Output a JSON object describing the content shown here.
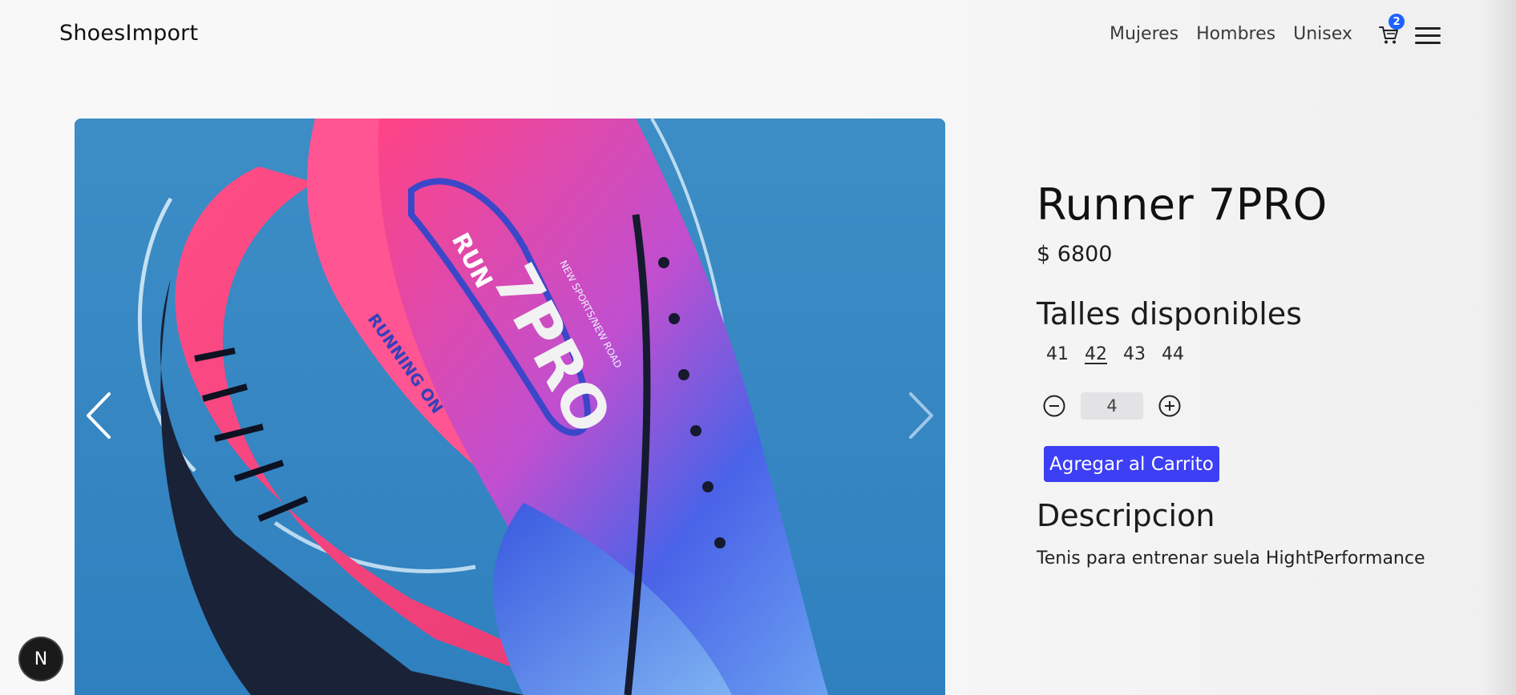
{
  "header": {
    "brand": "ShoesImport",
    "nav": [
      "Mujeres",
      "Hombres",
      "Unisex"
    ],
    "cart_count": "2"
  },
  "product": {
    "name": "Runner 7PRO",
    "price": "$ 6800",
    "sizes_title": "Talles disponibles",
    "sizes": [
      "41",
      "42",
      "43",
      "44"
    ],
    "selected_size": "42",
    "quantity": "4",
    "add_to_cart": "Agregar al Carrito",
    "description_title": "Descripcion",
    "description": "Tenis para entrenar suela HightPerformance"
  },
  "image_text": {
    "run": "RUN",
    "model": "7PRO",
    "tag": "RUNNING ON",
    "line": "NEW SPORTS/NEW ROAD"
  },
  "badge": "N",
  "colors": {
    "accent": "#3d3ff5",
    "cart_badge": "#1f62ff",
    "image_bg": "#3b8ac2",
    "shoe_pink": "#ff4f8a",
    "shoe_blue": "#3d5fe0"
  },
  "icons": {
    "cart": "cart-icon",
    "menu": "hamburger-menu-icon",
    "prev": "chevron-left-icon",
    "next": "chevron-right-icon",
    "minus": "minus-circle-icon",
    "plus": "plus-circle-icon"
  }
}
